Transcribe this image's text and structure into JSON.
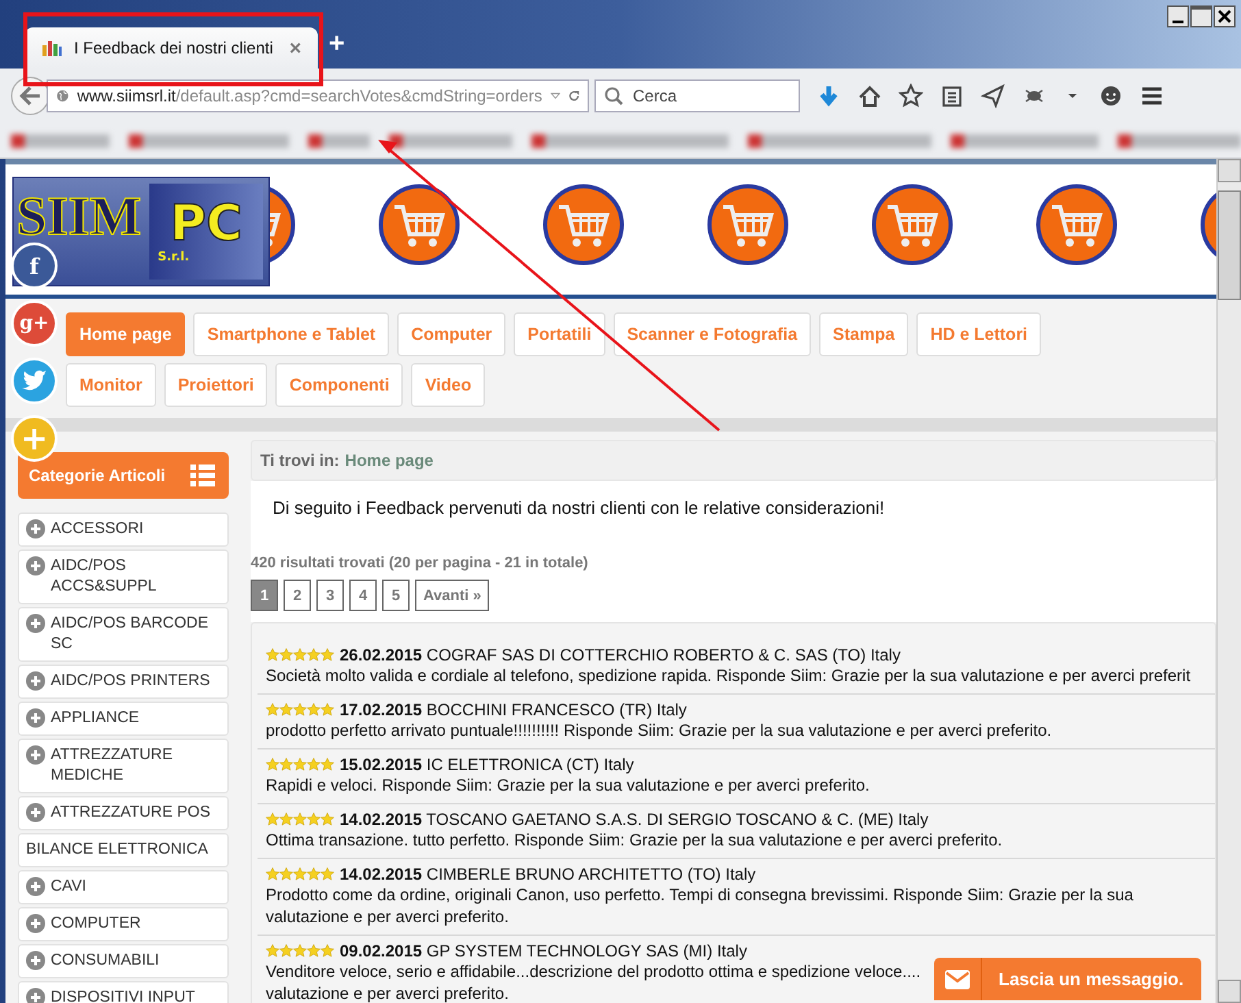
{
  "browser": {
    "tab": {
      "title": "I Feedback dei nostri clienti",
      "close": "×",
      "selected": true
    },
    "new_tab": "+",
    "url": {
      "host": "www.siimsrl.it",
      "path": "/default.asp?cmd=searchVotes&cmdString=orders"
    },
    "search": {
      "placeholder": "Cerca"
    }
  },
  "logo": {
    "text_1": "SIIM",
    "text_2": "PC",
    "text_3": "S.r.l."
  },
  "social": [
    {
      "kind": "facebook",
      "label": "f"
    },
    {
      "kind": "google",
      "label": "g+"
    },
    {
      "kind": "twitter"
    },
    {
      "kind": "add",
      "label": "+"
    }
  ],
  "menu": [
    {
      "label": "Home page",
      "selected": true
    },
    {
      "label": "Smartphone e Tablet",
      "selected": false
    },
    {
      "label": "Computer",
      "selected": false
    },
    {
      "label": "Portatili",
      "selected": false
    },
    {
      "label": "Scanner e Fotografia",
      "selected": false
    },
    {
      "label": "Stampa",
      "selected": false
    },
    {
      "label": "HD e Lettori",
      "selected": false
    },
    {
      "label": "Monitor",
      "selected": false
    },
    {
      "label": "Proiettori",
      "selected": false
    },
    {
      "label": "Componenti",
      "selected": false
    },
    {
      "label": "Video",
      "selected": false
    }
  ],
  "sidebar": {
    "title": "Categorie Articoli",
    "items": [
      {
        "label": "ACCESSORI",
        "expandable": true
      },
      {
        "label": "AIDC/POS ACCS&SUPPL",
        "expandable": true
      },
      {
        "label": "AIDC/POS BARCODE SC",
        "expandable": true
      },
      {
        "label": "AIDC/POS PRINTERS",
        "expandable": true
      },
      {
        "label": "APPLIANCE",
        "expandable": true
      },
      {
        "label": "ATTREZZATURE MEDICHE",
        "expandable": true
      },
      {
        "label": "ATTREZZATURE POS",
        "expandable": true
      },
      {
        "label": "BILANCE ELETTRONICA",
        "expandable": false
      },
      {
        "label": "CAVI",
        "expandable": true
      },
      {
        "label": "COMPUTER",
        "expandable": true
      },
      {
        "label": "CONSUMABILI",
        "expandable": true
      },
      {
        "label": "DISPOSITIVI INPUT",
        "expandable": true
      }
    ]
  },
  "breadcrumb": {
    "prefix": "Ti trovi in:",
    "link": "Home page"
  },
  "intro": "Di seguito i Feedback pervenuti da nostri clienti con le relative considerazioni!",
  "results": "420 risultati trovati (20 per pagina - 21 in totale)",
  "pagination": [
    {
      "label": "1",
      "selected": true
    },
    {
      "label": "2",
      "selected": false
    },
    {
      "label": "3",
      "selected": false
    },
    {
      "label": "4",
      "selected": false
    },
    {
      "label": "5",
      "selected": false
    },
    {
      "label": "Avanti »",
      "selected": false
    }
  ],
  "reviews": [
    {
      "stars": 5,
      "title": "**26.02.2015** COGRAF SAS DI COTTERCHIO ROBERTO & C. SAS (TO) Italy",
      "text": "Società molto valida e cordiale al telefono, spedizione rapida. Risponde Siim: Grazie per la sua valutazione e per averci preferit"
    },
    {
      "stars": 5,
      "title": "**17.02.2015** BOCCHINI FRANCESCO (TR) Italy",
      "text": "prodotto perfetto arrivato puntuale!!!!!!!!!! Risponde Siim: Grazie per la sua valutazione e per averci preferito."
    },
    {
      "stars": 5,
      "title": "**15.02.2015** IC ELETTRONICA (CT) Italy",
      "text": "Rapidi e veloci. Risponde Siim: Grazie per la sua valutazione e per averci preferito."
    },
    {
      "stars": 5,
      "title": "**14.02.2015** TOSCANO GAETANO S.A.S. DI SERGIO TOSCANO & C. (ME) Italy",
      "text": "Ottima transazione. tutto perfetto. Risponde Siim: Grazie per la sua valutazione e per averci preferito."
    },
    {
      "stars": 5,
      "title": "**14.02.2015** CIMBERLE BRUNO ARCHITETTO (TO) Italy",
      "text": "Prodotto come da ordine, originali Canon, uso perfetto. Tempi di consegna brevissimi. Risponde Siim: Grazie per la sua\nvalutazione e per averci preferito."
    },
    {
      "stars": 5,
      "title": "**09.02.2015** GP SYSTEM TECHNOLOGY SAS (MI) Italy",
      "text": "Venditore veloce, serio e affidabile...descrizione del prodotto ottima e spedizione veloce....\nvalutazione e per averci preferito."
    }
  ],
  "chat": {
    "label": "Lascia un messaggio."
  }
}
